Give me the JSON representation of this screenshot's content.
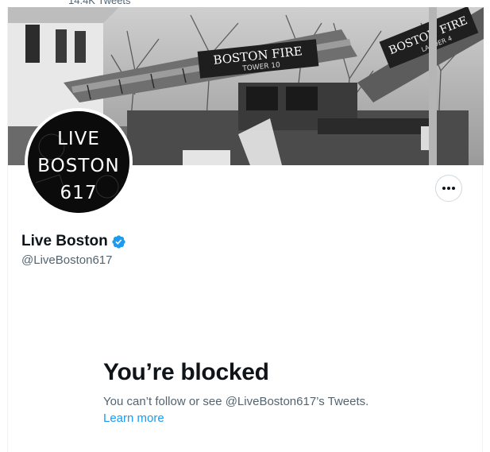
{
  "top_bar": {
    "text": "14.4K Tweets"
  },
  "banner": {
    "truck_sign_1": "BOSTON FIRE",
    "truck_sign_1_sub": "TOWER 10",
    "truck_sign_2": "BOSTON FIRE",
    "truck_sign_2_sub": "LADDER 4"
  },
  "avatar": {
    "line1": "LIVE",
    "line2": "BOSTON",
    "line3": "617"
  },
  "profile": {
    "display_name": "Live Boston",
    "handle": "@LiveBoston617",
    "verified": true
  },
  "blocked": {
    "title": "You’re blocked",
    "description": "You can’t follow or see @LiveBoston617’s Tweets.",
    "learn_more": "Learn more"
  },
  "colors": {
    "accent": "#1d9bf0",
    "text_primary": "#0f1419",
    "text_secondary": "#536471",
    "border": "#cfd9de"
  },
  "icons": {
    "more": "more-horizontal-icon",
    "verified": "verified-badge-icon"
  }
}
